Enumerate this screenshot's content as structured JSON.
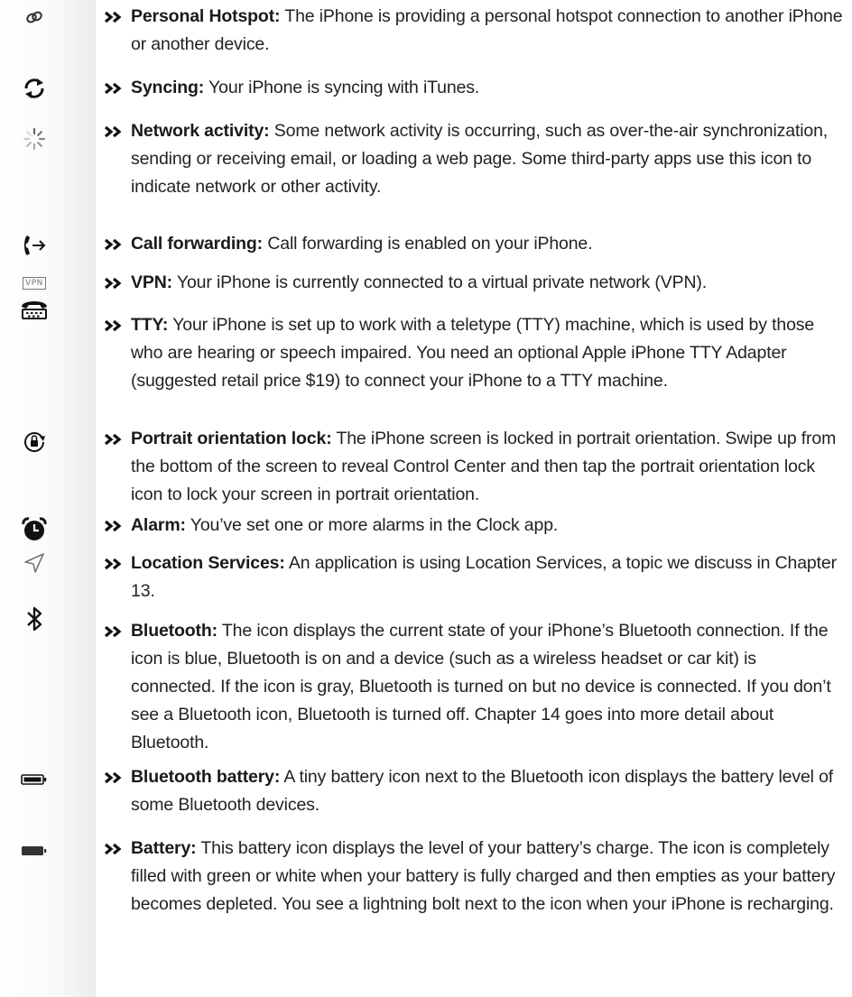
{
  "icons": {
    "personal_hotspot": "link-icon",
    "syncing": "sync-icon",
    "network_activity": "spinner-icon",
    "call_forwarding": "call-forward-icon",
    "vpn": "vpn-icon",
    "tty": "tty-icon",
    "orientation_lock": "orientation-lock-icon",
    "alarm": "alarm-clock-icon",
    "location": "location-arrow-icon",
    "bluetooth": "bluetooth-icon",
    "bluetooth_battery": "battery-icon",
    "battery": "battery-full-icon"
  },
  "vpn_icon_label": "VPN",
  "entries": [
    {
      "term": "Personal Hotspot:",
      "description": "The iPhone is providing a personal hotspot connection to another iPhone or another device."
    },
    {
      "term": "Syncing:",
      "description": "Your iPhone is syncing with iTunes."
    },
    {
      "term": "Network activity:",
      "description": "Some network activity is occurring, such as over-the-air synchronization, sending or receiving email, or loading a web page. Some third-party apps use this icon to indicate network or other activity."
    },
    {
      "term": "Call forwarding:",
      "description": "Call forwarding is enabled on your iPhone."
    },
    {
      "term": "VPN:",
      "description": "Your iPhone is currently connected to a virtual private network (VPN)."
    },
    {
      "term": "TTY:",
      "description": "Your iPhone is set up to work with a teletype (TTY) machine, which is used by those who are hearing or speech impaired. You need an optional Apple iPhone TTY Adapter (suggested retail price $19) to connect your iPhone to a TTY machine."
    },
    {
      "term": "Portrait orientation lock:",
      "description": "The iPhone screen is locked in portrait orientation. Swipe up from the bottom of the screen to reveal Control Center and then tap the portrait orientation lock icon to lock your screen in portrait orientation."
    },
    {
      "term": "Alarm:",
      "description": "You’ve set one or more alarms in the Clock app."
    },
    {
      "term": "Location Services:",
      "description": "An application is using Location Services, a topic we discuss in Chapter 13."
    },
    {
      "term": "Bluetooth:",
      "description": "The icon displays the current state of your iPhone’s Bluetooth connection. If the icon is blue, Bluetooth is on and a device (such as a wireless headset or car kit) is connected. If the icon is gray, Bluetooth is turned on but no device is connected. If you don’t see a Bluetooth icon, Bluetooth is turned off. Chapter 14 goes into more detail about Bluetooth."
    },
    {
      "term": "Bluetooth battery:",
      "description": "A tiny battery icon next to the Bluetooth icon displays the battery level of some Bluetooth devices."
    },
    {
      "term": "Battery:",
      "description": "This battery icon displays the level of your battery’s charge. The icon is completely filled with green or white when your battery is fully charged and then empties as your battery becomes depleted. You see a lightning bolt next to the icon when your iPhone is recharging."
    }
  ]
}
